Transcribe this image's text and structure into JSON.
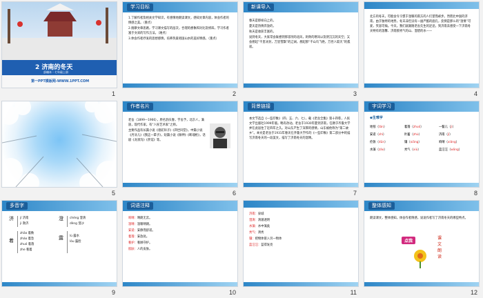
{
  "slides": [
    {
      "n": "1",
      "title": "2 济南的冬天",
      "sub": "部编本・七年级上册",
      "foot": "第一PPT模板网-WWW.1PPT.COM"
    },
    {
      "n": "2",
      "tag": "学习目标",
      "lines": [
        "1.了解作者及相关文学知识，有感情地朗读课文，感知文章内容，体会作者的情感之美。（重点）",
        "2.揣摩文章思路，学习课文描写的层次，合理的想象和对比及修辞，学习作者富于文采的写作方法。（难点）",
        "3.体会作者抒发的思想感情，培养热爱祖国山水的美好情感。（重点）"
      ]
    },
    {
      "n": "3",
      "tag": "新课导入",
      "lines": [
        "春天是那样向上的，",
        "夏天是热情奔放的，",
        "秋天是收获丰富的，",
        "说到冬天，大家常会联想到那凛冽的北风，刺骨的寒风以及阴沉沉的天空；又会想起“千里冰封，万里雪飘”的辽阔，想起那“千山鸟飞绝，万径人踪灭”的孤寂。"
      ]
    },
    {
      "n": "4",
      "lines": [
        "北方的冬天，可能会令习惯于温暖的南方的人们望而却步。然而北中国的济南，由于独特的地势，冬天非但没有一副严酷的面孔，反倒是那么的“温情”可爱，笑容可掬。今天，我们就跟随老舍先生的足迹，到济南去感受一下济南冬天特有的温馨、济南那秀气的山、澄碧的水——"
      ]
    },
    {
      "n": "5"
    },
    {
      "n": "6",
      "tag": "作者名片",
      "lines": [
        "老舍（1899—1966），原名舒庆春，字舍予，北京人，满族，现代作家，有“人民艺术家”之称。",
        "主要作品有长篇小说《骆驼祥子》《四世同堂》，中篇小说《月牙儿》《我这一辈子》，短篇小说《微神》《断魂枪》，话剧《龙须沟》《茶馆》等。"
      ]
    },
    {
      "n": "7",
      "tag": "背景链接",
      "lines": [
        "本文节选自《一些印象》（四、五、六、七），载《老舍全集》第十四卷，人民文学出版社1999年版。略有改动。老舍于1930年夏到济南，任教于齐鲁大学并在此居住了近四年之久。对山东产生了深厚的感情，山东被他称为“第二故乡”。本文是老舍于1931年春天在齐鲁大学作的《一些印象》第二部分中的描写济南冬天的一段美文，描写了济南冬天的温晴。"
      ]
    },
    {
      "n": "8",
      "tag": "字词学习",
      "sec": "◆生难字",
      "pairs": [
        [
          "地毯",
          "tǎn"
        ],
        [
          "着落",
          "zhuó"
        ],
        [
          "一髻儿",
          "jì"
        ],
        [
          "安适",
          "shì"
        ],
        [
          "贮蓄",
          "zhù"
        ],
        [
          "济南",
          "jǐ"
        ],
        [
          "伦敦",
          "dūn"
        ],
        [
          "镶",
          "xiāng"
        ],
        [
          "响晴",
          "xiǎng"
        ],
        [
          "水藻",
          "zǎo"
        ],
        [
          "秀气",
          "xiù"
        ],
        [
          "蓝汪汪",
          "wāng"
        ]
      ]
    },
    {
      "n": "9",
      "tag": "多音字",
      "groups": [
        [
          "济",
          "jǐ 济南",
          "jì 救济"
        ],
        [
          "澄",
          "chéng 澄清",
          "dèng 澄沙"
        ],
        [
          "着",
          "zhāo 着数",
          "zháo 着急",
          "zhuó 着落",
          "zhe 看着"
        ],
        [
          "露",
          "lù 露水",
          "lòu 露脸"
        ]
      ]
    },
    {
      "n": "10",
      "tag": "词语注释",
      "defs": [
        [
          "响晴：",
          "晴朗无云。"
        ],
        [
          "温晴：",
          "温暖晴朗。"
        ],
        [
          "安适：",
          "安静而舒适。"
        ],
        [
          "着落：",
          "安放处。"
        ],
        [
          "看护：",
          "看顾守护。"
        ],
        [
          "肌肤：",
          "人的皮肤。"
        ]
      ]
    },
    {
      "n": "11",
      "defs": [
        [
          "济南：",
          "泉城"
        ],
        [
          "澄清：",
          "清澈透明"
        ],
        [
          "水藻：",
          "水中藻类"
        ],
        [
          "秀气：",
          "清秀"
        ],
        [
          "镶：",
          "把物体嵌入另一物体"
        ],
        [
          "蓝汪汪：",
          "蓝得发亮"
        ]
      ]
    },
    {
      "n": "12",
      "tag": "整体感知",
      "lines": [
        "朗读课文，整体感知，体会作者情感，说说作者写了济南冬天的哪些特点。"
      ],
      "badge": "点我",
      "vert": [
        "课",
        "文",
        "朗",
        "读"
      ]
    }
  ]
}
